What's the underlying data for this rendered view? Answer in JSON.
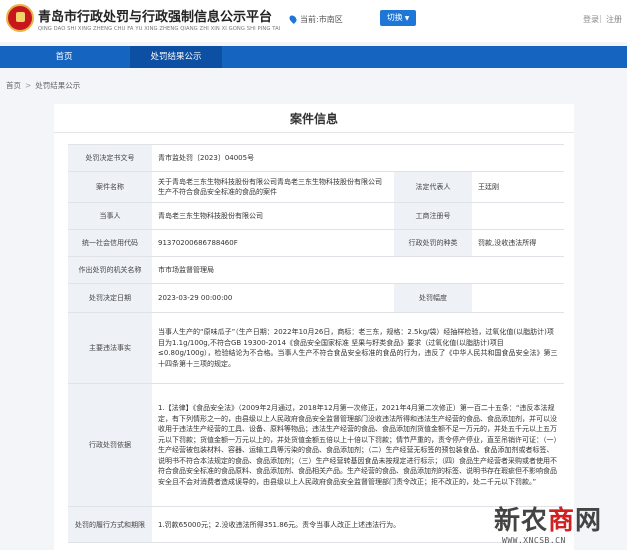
{
  "header": {
    "title": "青岛市行政处罚与行政强制信息公示平台",
    "subtitle": "QING DAO SHI XING ZHENG CHU FA YU XING ZHENG QIANG ZHI XIN XI GONG SHI PING TAI",
    "location": "当前:市南区",
    "switch_label": "切换",
    "login": "登录",
    "separator": "|",
    "register": "注册"
  },
  "nav": {
    "home": "首页",
    "results": "处罚结果公示"
  },
  "breadcrumb": {
    "home": "首页",
    "arrow": ">",
    "current": "处罚结果公示"
  },
  "card": {
    "title": "案件信息",
    "doc_no_label": "处罚决定书文号",
    "doc_no": "青市监处罚〔2023〕04005号",
    "case_name_label": "案件名称",
    "case_name": "关于青岛老三东生物科技股份有限公司青岛老三东生物科技股份有限公司生产不符合食品安全标准的食品的案件",
    "legal_rep_label": "法定代表人",
    "legal_rep": "王廷刚",
    "party_label": "当事人",
    "party": "青岛老三东生物科技股份有限公司",
    "reg_no_label": "工商注册号",
    "reg_no": "",
    "credit_code_label": "统一社会信用代码",
    "credit_code": "91370200686788460F",
    "penalty_type_label": "行政处罚的种类",
    "penalty_type": "罚款,没收违法所得",
    "authority_label": "作出处罚的机关名称",
    "authority": "市市场监督管理局",
    "date_label": "处罚决定日期",
    "date": "2023-03-29 00:00:00",
    "range_label": "处罚幅度",
    "range": "",
    "facts_label": "主要违法事实",
    "facts": "当事人生产的“原味瓜子”（生产日期：2022年10月26日，商标：老三东，规格：2.5kg/袋）经抽样检验，过氧化值(以脂肪计)项目为1.1g/100g,不符合GB 19300-2014《食品安全国家标准 坚果与籽类食品》要求（过氧化值(以脂肪计)项目≤0.80g/100g），检验结论为不合格。当事人生产不符合食品安全标准的食品的行为，违反了《中华人民共和国食品安全法》第三十四条第十三项的规定。",
    "basis_label": "行政处罚依据",
    "basis": "1.【法律】《食品安全法》（2009年2月通过，2018年12月第一次修正，2021年4月第二次修正）第一百二十五条：“违反本法规定，有下列情形之一的，由县级以上人民政府食品安全监督管理部门没收违法所得和违法生产经营的食品、食品添加剂，并可以没收用于违法生产经营的工具、设备、原料等物品；违法生产经营的食品、食品添加剂货值金额不足一万元的，并处五千元以上五万元以下罚款；货值金额一万元以上的，并处货值金额五倍以上十倍以下罚款；情节严重的，责令停产停业，直至吊销许可证：（一）生产经营被包装材料、容器、运输工具等污染的食品、食品添加剂；（二）生产经营无标签的预包装食品、食品添加剂或者标签、说明书不符合本法规定的食品、食品添加剂；（三）生产经营转基因食品未按规定进行标示；（四）食品生产经营者采购或者使用不符合食品安全标准的食品原料、食品添加剂、食品相关产品。生产经营的食品、食品添加剂的标签、说明书存在瑕疵但不影响食品安全且不会对消费者造成误导的，由县级以上人民政府食品安全监督管理部门责令改正；拒不改正的，处二千元以下罚款。”",
    "result_label": "处罚的履行方式和期限",
    "result": "1.罚款65000元；2.没收违法所得351.86元。责令当事人改正上述违法行为。"
  },
  "watermark": {
    "logo_a": "新农",
    "logo_b": "商",
    "logo_c": "网",
    "url": "WWW.XNCSB.CN"
  }
}
